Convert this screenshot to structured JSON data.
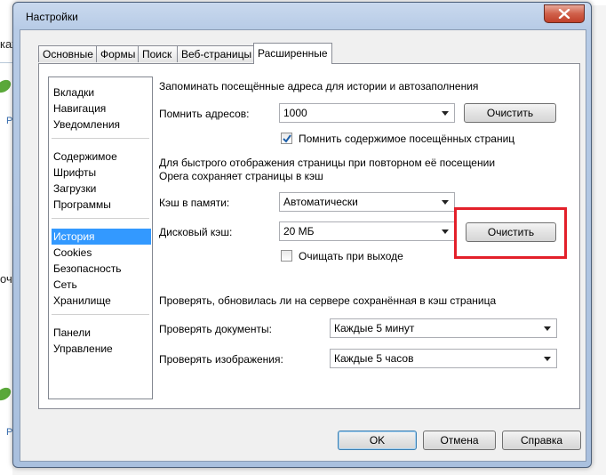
{
  "background": {
    "top_text": "...",
    "left_fragment_1": "каж",
    "left_fragment_2": "очи",
    "left_link_1": "Ре",
    "left_link_2": "Ре",
    "left_link_3": "Ре"
  },
  "window": {
    "title": "Настройки"
  },
  "tabs": [
    {
      "label": "Основные"
    },
    {
      "label": "Формы"
    },
    {
      "label": "Поиск"
    },
    {
      "label": "Веб-страницы"
    },
    {
      "label": "Расширенные",
      "active": true
    }
  ],
  "sidebar": {
    "items": [
      {
        "label": "Вкладки"
      },
      {
        "label": "Навигация"
      },
      {
        "label": "Уведомления"
      },
      {
        "label": "Содержимое"
      },
      {
        "label": "Шрифты"
      },
      {
        "label": "Загрузки"
      },
      {
        "label": "Программы"
      },
      {
        "label": "История",
        "selected": true
      },
      {
        "label": "Cookies"
      },
      {
        "label": "Безопасность"
      },
      {
        "label": "Сеть"
      },
      {
        "label": "Хранилище"
      },
      {
        "label": "Панели"
      },
      {
        "label": "Управление"
      }
    ]
  },
  "history": {
    "section_title": "Запоминать посещённые адреса для истории и автозаполнения",
    "remember_label": "Помнить адресов:",
    "remember_value": "1000",
    "clear_button": "Очистить",
    "remember_content_label": "Помнить содержимое посещённых страниц",
    "remember_content_checked": true
  },
  "cache": {
    "description_line1": "Для быстрого отображения страницы при повторном её посещении",
    "description_line2": "Opera сохраняет страницы в кэш",
    "memory_label": "Кэш в памяти:",
    "memory_value": "Автоматически",
    "disk_label": "Дисковый кэш:",
    "disk_value": "20 МБ",
    "clear_button": "Очистить",
    "clear_on_exit_label": "Очищать при выходе",
    "clear_on_exit_checked": false
  },
  "check": {
    "section_title": "Проверять, обновилась ли на сервере сохранённая в кэш страница",
    "documents_label": "Проверять документы:",
    "documents_value": "Каждые 5 минут",
    "images_label": "Проверять изображения:",
    "images_value": "Каждые 5 часов"
  },
  "footer": {
    "ok": "OK",
    "cancel": "Отмена",
    "help": "Справка"
  },
  "colors": {
    "highlight": "#e3202a",
    "selection": "#3399ff"
  }
}
